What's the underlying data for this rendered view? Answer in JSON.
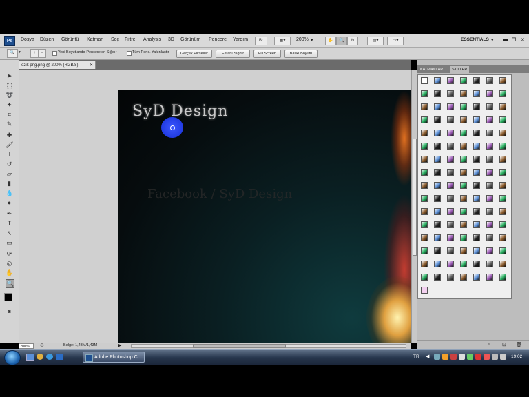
{
  "menubar": {
    "logo": "Ps",
    "items": [
      "Dosya",
      "Düzen",
      "Görüntü",
      "Katman",
      "Seç",
      "Filtre",
      "Analysis",
      "3D",
      "Görünüm",
      "Pencere",
      "Yardım"
    ],
    "zoom_value": "200%",
    "workspace": "ESSENTIALS"
  },
  "options": {
    "resize_windows_label": "Yeni Boyutlandır Pencereleri Sığdır",
    "zoom_all_label": "Tüm Penc. Yakınlaştır",
    "buttons": [
      "Gerçek Pikseller",
      "Ekranı Sığdır",
      "Fill Screen",
      "Baskı Boyutu"
    ]
  },
  "document": {
    "tab_title": "ezik png.png @ 200% (RGB/8)",
    "logo_text": "SyD Design",
    "watermark_text": "Facebook / SyD Design"
  },
  "status": {
    "zoom": "200%",
    "doc_size": "Belge: 1,43M/1,43M"
  },
  "panel": {
    "tabs": [
      "KATMANLAR",
      "STİLLER"
    ],
    "active_tab": "STİLLER"
  },
  "taskbar": {
    "task_label": "Adobe Photoshop C...",
    "language": "TR",
    "clock": "19:02"
  },
  "colors": {
    "accent": "#1e4f8f",
    "cursor": "#2a44f0"
  }
}
